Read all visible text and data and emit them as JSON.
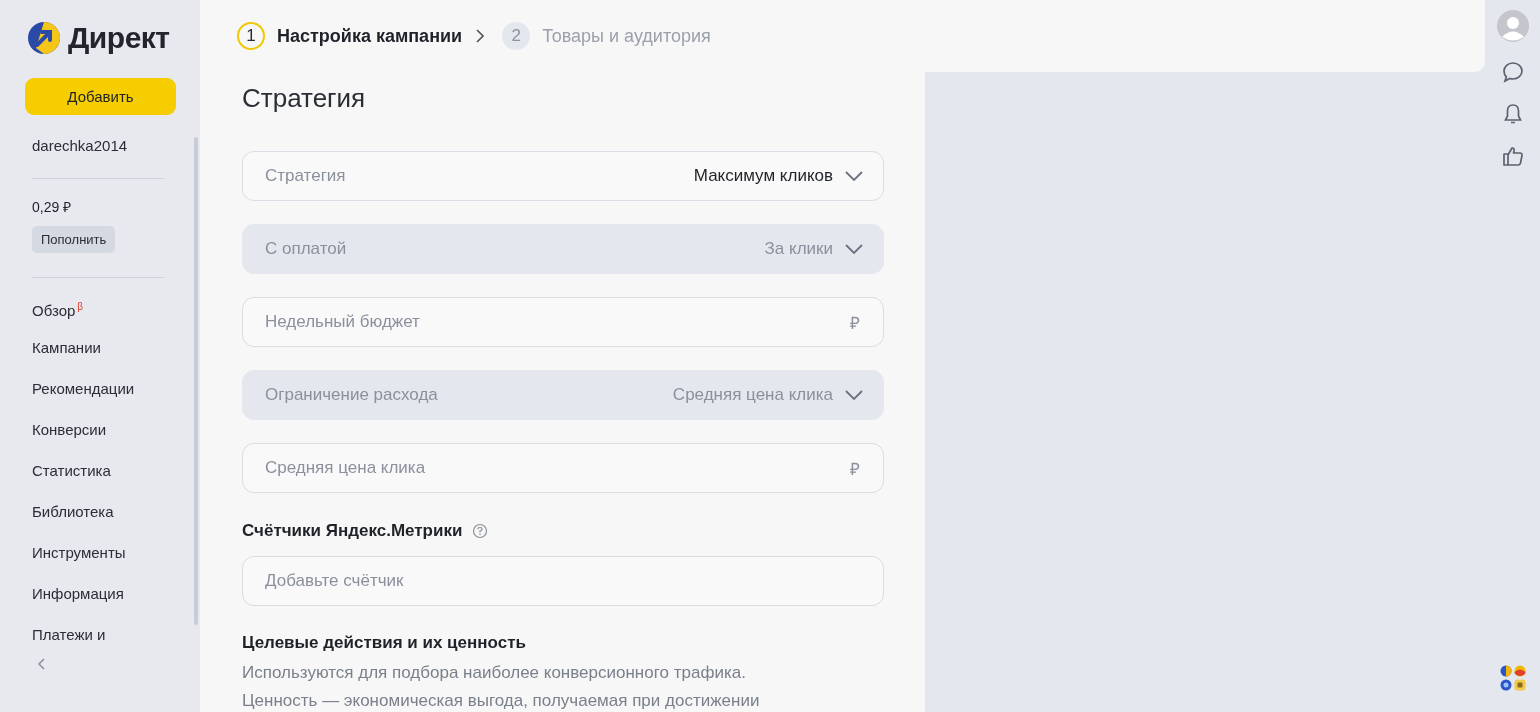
{
  "sidebar": {
    "logo_text": "Директ",
    "add_button": "Добавить",
    "account": "darechka2014",
    "balance": "0,29 ₽",
    "top_up_button": "Пополнить",
    "nav": [
      {
        "label": "Обзор",
        "badge": "β"
      },
      {
        "label": "Кампании"
      },
      {
        "label": "Рекомендации"
      },
      {
        "label": "Конверсии"
      },
      {
        "label": "Статистика"
      },
      {
        "label": "Библиотека"
      },
      {
        "label": "Инструменты"
      },
      {
        "label": "Информация"
      },
      {
        "label": "Платежи и"
      }
    ]
  },
  "steps": [
    {
      "number": "1",
      "label": "Настройка кампании",
      "selected": true
    },
    {
      "number": "2",
      "label": "Товары и аудитория",
      "selected": false
    }
  ],
  "section_title": "Стратегия",
  "fields": [
    {
      "kind": "select",
      "label": "Стратегия",
      "value": "Максимум кликов",
      "disabled": false
    },
    {
      "kind": "select",
      "label": "С оплатой",
      "value": "За клики",
      "disabled": true
    },
    {
      "kind": "input",
      "placeholder": "Недельный бюджет",
      "suffix": "₽",
      "disabled": false
    },
    {
      "kind": "select",
      "label": "Ограничение расхода",
      "value": "Средняя цена клика",
      "disabled": true
    },
    {
      "kind": "input",
      "placeholder": "Средняя цена клика",
      "suffix": "₽",
      "disabled": false
    }
  ],
  "counters": {
    "title": "Счётчики Яндекс.Метрики",
    "placeholder": "Добавьте счётчик"
  },
  "goals": {
    "title": "Целевые действия и их ценность",
    "text": "Используются для подбора наиболее конверсионного трафика. Ценность — экономическая выгода, получаемая при достижении"
  }
}
